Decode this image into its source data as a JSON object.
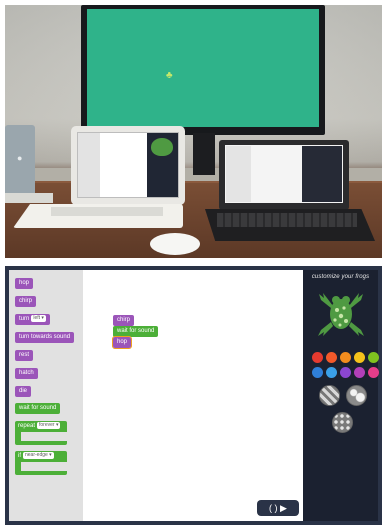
{
  "photo": {
    "monitor_color": "#2fb38a",
    "frog_glyph": "♣"
  },
  "app": {
    "palette_blocks": [
      {
        "label": "hop",
        "color": "purple"
      },
      {
        "label": "chirp",
        "color": "purple"
      },
      {
        "label": "turn",
        "chip": "left ▾",
        "color": "purple"
      },
      {
        "label": "turn towards sound",
        "color": "purple"
      },
      {
        "label": "rest",
        "color": "purple"
      },
      {
        "label": "hatch",
        "color": "purple"
      },
      {
        "label": "die",
        "color": "purple"
      },
      {
        "label": "wait for sound",
        "color": "green"
      }
    ],
    "repeat_block": {
      "label": "repeat",
      "chip": "forever ▾"
    },
    "if_block": {
      "label": "if",
      "chip": "near-edge ▾"
    },
    "workspace_blocks": [
      {
        "label": "chirp",
        "color": "purple"
      },
      {
        "label": "wait for sound",
        "color": "green"
      },
      {
        "label": "hop",
        "color": "purple",
        "selected": true
      }
    ],
    "run_button": {
      "icon": "( )  ▶"
    },
    "sidebar": {
      "title": "customize your frogs",
      "colors": [
        "#e53a2f",
        "#f2592a",
        "#f28c1e",
        "#f5c21b",
        "#7fc31f",
        "#2f7fd8",
        "#3aa0e8",
        "#8b46d1",
        "#b23fb8",
        "#e63d8a"
      ],
      "patterns": [
        "striped",
        "spotted",
        "dotted"
      ]
    }
  }
}
